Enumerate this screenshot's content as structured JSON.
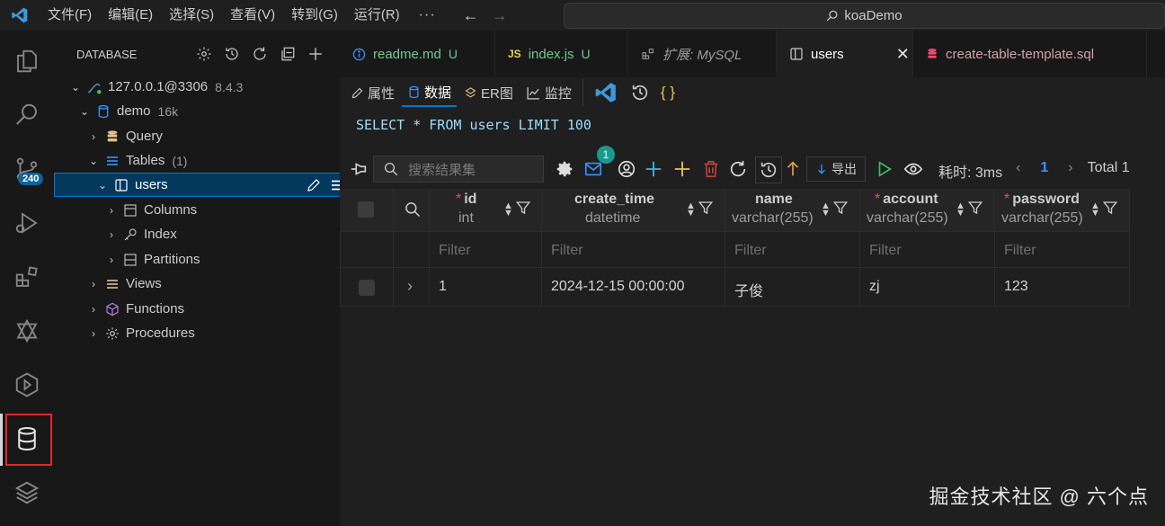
{
  "menu": [
    "文件(F)",
    "编辑(E)",
    "选择(S)",
    "查看(V)",
    "转到(G)",
    "运行(R)",
    "···"
  ],
  "search": {
    "label": "koaDemo"
  },
  "activity": {
    "scm_badge": "240"
  },
  "sidebar": {
    "title": "DATABASE",
    "connection": {
      "label": "127.0.0.1@3306",
      "version": "8.4.3"
    },
    "database": {
      "label": "demo",
      "size": "16k"
    },
    "query": "Query",
    "tables": {
      "label": "Tables",
      "count": "(1)"
    },
    "table": "users",
    "columns": "Columns",
    "index": "Index",
    "partitions": "Partitions",
    "views": "Views",
    "functions": "Functions",
    "procedures": "Procedures"
  },
  "tabs": [
    {
      "label": "readme.md",
      "status": "U"
    },
    {
      "label": "index.js",
      "status": "U"
    },
    {
      "label": "扩展: MySQL"
    },
    {
      "label": "users"
    },
    {
      "label": "create-table-template.sql"
    }
  ],
  "subtabs": {
    "props": "属性",
    "data": "数据",
    "er": "ER图",
    "monitor": "监控"
  },
  "sql": {
    "select": "SELECT",
    "star": "*",
    "from": "FROM",
    "table": "users",
    "limit": "LIMIT",
    "num": "100"
  },
  "toolbar": {
    "search_placeholder": "搜索结果集",
    "mail_badge": "1",
    "export": "导出",
    "timing": "耗时: 3ms",
    "page": "1",
    "total": "Total 1"
  },
  "table": {
    "columns": [
      {
        "name": "id",
        "type": "int",
        "required": true
      },
      {
        "name": "create_time",
        "type": "datetime",
        "required": false
      },
      {
        "name": "name",
        "type": "varchar(255)",
        "required": false
      },
      {
        "name": "account",
        "type": "varchar(255)",
        "required": true
      },
      {
        "name": "password",
        "type": "varchar(255)",
        "required": true
      }
    ],
    "filter_placeholder": "Filter",
    "rows": [
      [
        "1",
        "2024-12-15 00:00:00",
        "子俊",
        "zj",
        "123"
      ]
    ]
  },
  "colors": {
    "accent": "#0078d4",
    "required": "#f14c4c",
    "git": "#73c991",
    "highlight": "#e0292e"
  },
  "watermark": "掘金技术社区 @ 六个点"
}
